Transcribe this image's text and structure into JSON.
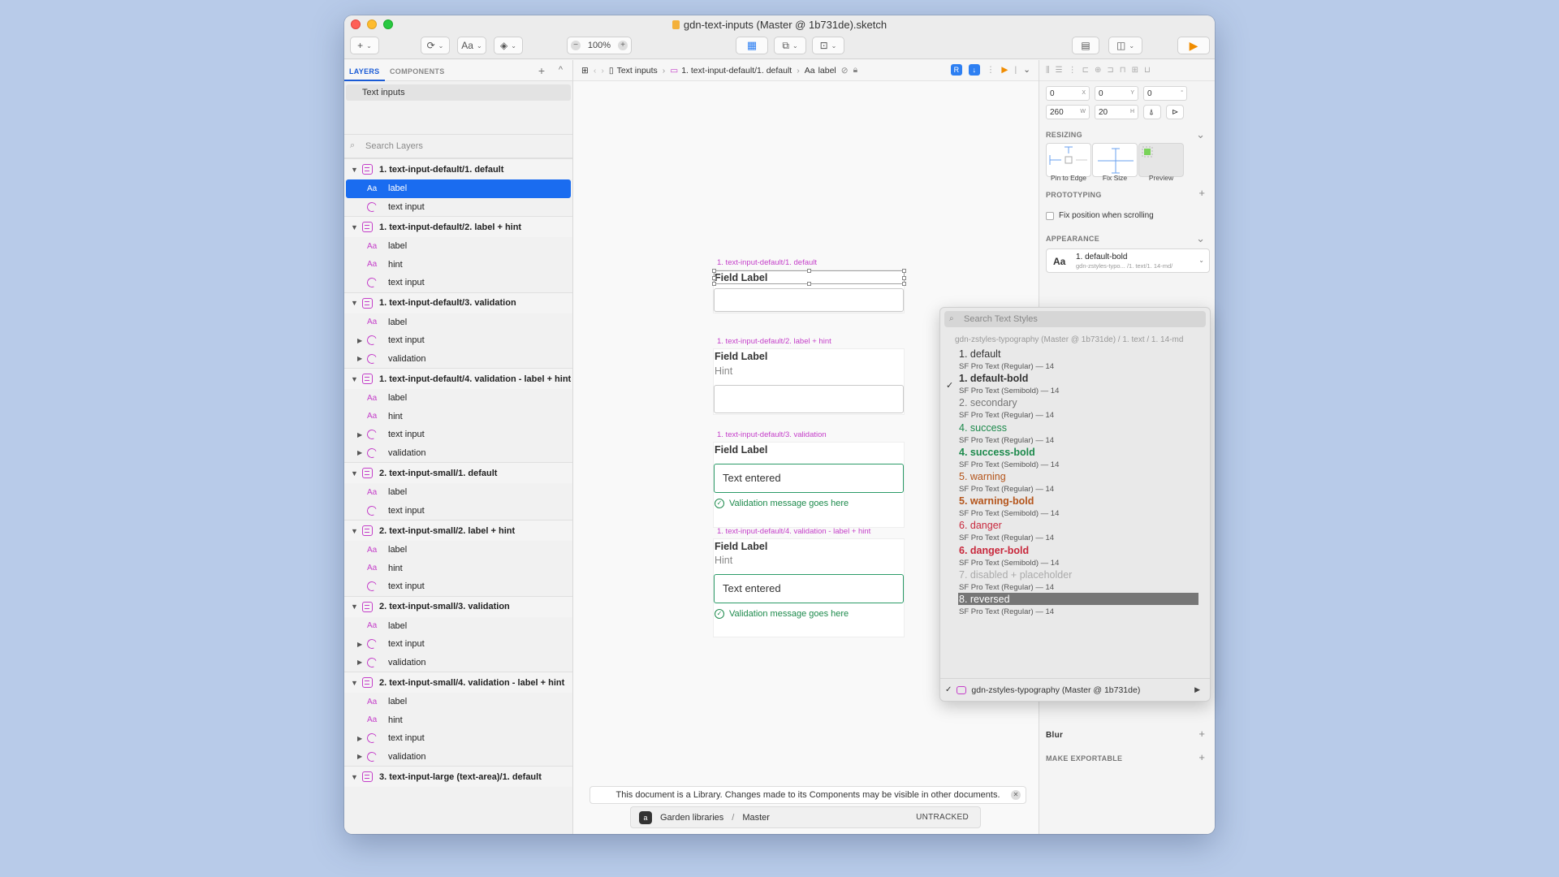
{
  "window": {
    "title": "gdn-text-inputs (Master @ 1b731de).sketch"
  },
  "toolbar": {
    "insert_label": "+",
    "text_label": "Aa",
    "zoom_out": "−",
    "zoom_value": "100%",
    "zoom_in": "+"
  },
  "layers_panel": {
    "tabs": [
      "LAYERS",
      "COMPONENTS"
    ],
    "add_label": "+",
    "collapse_label": "^",
    "page": "Text inputs",
    "search_placeholder": "Search Layers",
    "groups": [
      {
        "name": "1. text-input-default/1. default",
        "items": [
          {
            "type": "text",
            "label": "label",
            "selected": true,
            "expandable": false
          },
          {
            "type": "instance",
            "label": "text input",
            "selected": false,
            "expandable": false
          }
        ]
      },
      {
        "name": "1. text-input-default/2. label + hint",
        "items": [
          {
            "type": "text",
            "label": "label",
            "selected": false,
            "expandable": false
          },
          {
            "type": "text",
            "label": "hint",
            "selected": false,
            "expandable": false
          },
          {
            "type": "instance",
            "label": "text input",
            "selected": false,
            "expandable": false
          }
        ]
      },
      {
        "name": "1. text-input-default/3. validation",
        "items": [
          {
            "type": "text",
            "label": "label",
            "selected": false,
            "expandable": false
          },
          {
            "type": "instance",
            "label": "text input",
            "selected": false,
            "expandable": true
          },
          {
            "type": "instance",
            "label": "validation",
            "selected": false,
            "expandable": true
          }
        ]
      },
      {
        "name": "1. text-input-default/4. validation - label + hint",
        "items": [
          {
            "type": "text",
            "label": "label",
            "selected": false,
            "expandable": false
          },
          {
            "type": "text",
            "label": "hint",
            "selected": false,
            "expandable": false
          },
          {
            "type": "instance",
            "label": "text input",
            "selected": false,
            "expandable": true
          },
          {
            "type": "instance",
            "label": "validation",
            "selected": false,
            "expandable": true
          }
        ]
      },
      {
        "name": "2. text-input-small/1. default",
        "items": [
          {
            "type": "text",
            "label": "label",
            "selected": false,
            "expandable": false
          },
          {
            "type": "instance",
            "label": "text input",
            "selected": false,
            "expandable": false
          }
        ]
      },
      {
        "name": "2. text-input-small/2. label + hint",
        "items": [
          {
            "type": "text",
            "label": "label",
            "selected": false,
            "expandable": false
          },
          {
            "type": "text",
            "label": "hint",
            "selected": false,
            "expandable": false
          },
          {
            "type": "instance",
            "label": "text input",
            "selected": false,
            "expandable": false
          }
        ]
      },
      {
        "name": "2. text-input-small/3. validation",
        "items": [
          {
            "type": "text",
            "label": "label",
            "selected": false,
            "expandable": false
          },
          {
            "type": "instance",
            "label": "text input",
            "selected": false,
            "expandable": true
          },
          {
            "type": "instance",
            "label": "validation",
            "selected": false,
            "expandable": true
          }
        ]
      },
      {
        "name": "2. text-input-small/4. validation - label + hint",
        "items": [
          {
            "type": "text",
            "label": "label",
            "selected": false,
            "expandable": false
          },
          {
            "type": "text",
            "label": "hint",
            "selected": false,
            "expandable": false
          },
          {
            "type": "instance",
            "label": "text input",
            "selected": false,
            "expandable": true
          },
          {
            "type": "instance",
            "label": "validation",
            "selected": false,
            "expandable": true
          }
        ]
      },
      {
        "name": "3. text-input-large (text-area)/1. default",
        "items": []
      }
    ]
  },
  "breadcrumb": {
    "page": "Text inputs",
    "artboard": "1. text-input-default/1. default",
    "layer": "label"
  },
  "canvas": {
    "artboards": [
      {
        "title": "1. text-input-default/1. default",
        "label": "Field Label"
      },
      {
        "title": "1. text-input-default/2. label + hint",
        "label": "Field Label",
        "hint": "Hint"
      },
      {
        "title": "1. text-input-default/3. validation",
        "label": "Field Label",
        "value": "Text entered",
        "validation": "Validation message goes here"
      },
      {
        "title": "1. text-input-default/4. validation - label + hint",
        "label": "Field Label",
        "hint": "Hint",
        "value": "Text entered",
        "validation": "Validation message goes here"
      }
    ],
    "notice": "This document is a Library. Changes made to its Components may be visible in other documents.",
    "vcs": {
      "repo": "Garden libraries",
      "branch": "Master",
      "status": "UNTRACKED"
    }
  },
  "inspector": {
    "x": "0",
    "x_unit": "X",
    "y": "0",
    "y_unit": "Y",
    "rotation": "0",
    "rotation_unit": "°",
    "w": "260",
    "w_unit": "W",
    "h": "20",
    "h_unit": "H",
    "resizing_title": "RESIZING",
    "resizing_options": [
      "Pin to Edge",
      "Fix Size",
      "Preview"
    ],
    "prototyping_title": "PROTOTYPING",
    "fix_position_label": "Fix position when scrolling",
    "appearance_title": "APPEARANCE",
    "style_name": "1. default-bold",
    "style_path": "gdn-zstyles-typo... /1. text/1. 14-md/",
    "blur_title": "Blur",
    "export_title": "MAKE EXPORTABLE"
  },
  "text_styles_popover": {
    "search_placeholder": "Search Text Styles",
    "library_header": "gdn-zstyles-typography (Master @ 1b731de) / 1. text / 1. 14-md",
    "options": [
      {
        "name": "1. default",
        "desc": "SF Pro Text (Regular) — 14",
        "color": "#333333",
        "bold": false,
        "checked": false,
        "highlighted": false
      },
      {
        "name": "1. default-bold",
        "desc": "SF Pro Text (Semibold) — 14",
        "color": "#333333",
        "bold": true,
        "checked": true,
        "highlighted": false
      },
      {
        "name": "2. secondary",
        "desc": "SF Pro Text (Regular) — 14",
        "color": "#777777",
        "bold": false,
        "checked": false,
        "highlighted": false
      },
      {
        "name": "4. success",
        "desc": "SF Pro Text (Regular) — 14",
        "color": "#1d8a4c",
        "bold": false,
        "checked": false,
        "highlighted": false
      },
      {
        "name": "4. success-bold",
        "desc": "SF Pro Text (Semibold) — 14",
        "color": "#1d8a4c",
        "bold": true,
        "checked": false,
        "highlighted": false
      },
      {
        "name": "5. warning",
        "desc": "SF Pro Text (Regular) — 14",
        "color": "#b4541a",
        "bold": false,
        "checked": false,
        "highlighted": false
      },
      {
        "name": "5. warning-bold",
        "desc": "SF Pro Text (Semibold) — 14",
        "color": "#b4541a",
        "bold": true,
        "checked": false,
        "highlighted": false
      },
      {
        "name": "6. danger",
        "desc": "SF Pro Text (Regular) — 14",
        "color": "#c8283c",
        "bold": false,
        "checked": false,
        "highlighted": false
      },
      {
        "name": "6. danger-bold",
        "desc": "SF Pro Text (Semibold) — 14",
        "color": "#c8283c",
        "bold": true,
        "checked": false,
        "highlighted": false
      },
      {
        "name": "7. disabled + placeholder",
        "desc": "SF Pro Text (Regular) — 14",
        "color": "#aaaaaa",
        "bold": false,
        "checked": false,
        "highlighted": false
      },
      {
        "name": "8. reversed",
        "desc": "SF Pro Text (Regular) — 14",
        "color": "#ffffff",
        "bold": false,
        "checked": false,
        "highlighted": true
      }
    ],
    "library": "gdn-zstyles-typography (Master @ 1b731de)"
  },
  "colors": {
    "accent": "#1a6cf0",
    "symbol": "#c43ec9",
    "success": "#1d8a4c"
  }
}
